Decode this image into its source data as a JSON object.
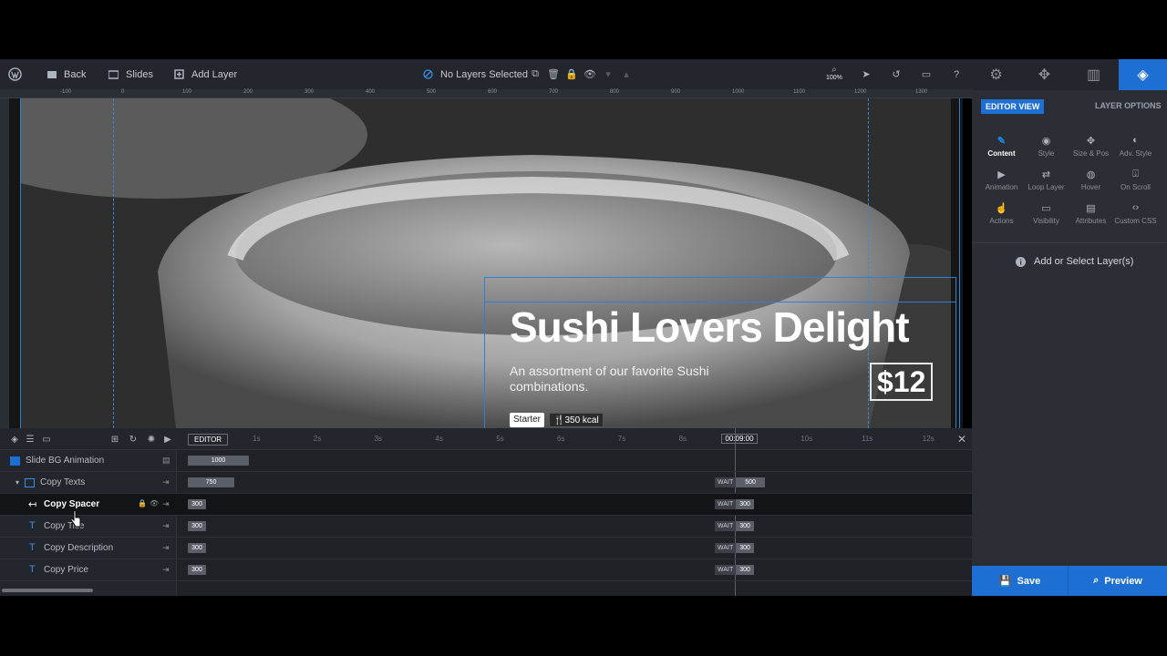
{
  "toolbar": {
    "back_label": "Back",
    "slides_label": "Slides",
    "add_layer_label": "Add Layer",
    "selection_status": "No Layers Selected",
    "zoom": "100%"
  },
  "ruler": {
    "ticks": [
      "-100",
      "0",
      "100",
      "200",
      "300",
      "400",
      "500",
      "600",
      "700",
      "800",
      "900",
      "1000",
      "1100",
      "1200",
      "1300"
    ]
  },
  "canvas": {
    "title": "Sushi Lovers Delight",
    "description": "An assortment of our favorite Sushi combinations.",
    "price": "$12",
    "tag_starter": "Starter",
    "tag_kcal": "¥¥ 350 kcal"
  },
  "timeline": {
    "editor_label": "EDITOR",
    "ticks": [
      "1s",
      "2s",
      "3s",
      "4s",
      "5s",
      "6s",
      "7s",
      "8s",
      "00:09:00",
      "10s",
      "11s",
      "12s"
    ],
    "rows": [
      {
        "name": "Slide BG Animation",
        "start": "1000",
        "wait": "",
        "end": ""
      },
      {
        "name": "Copy Texts",
        "start": "750",
        "wait": "WAIT",
        "end": "500"
      },
      {
        "name": "Copy Spacer",
        "start": "300",
        "wait": "WAIT",
        "end": "300"
      },
      {
        "name": "Copy Title",
        "start": "300",
        "wait": "WAIT",
        "end": "300"
      },
      {
        "name": "Copy Description",
        "start": "300",
        "wait": "WAIT",
        "end": "300"
      },
      {
        "name": "Copy Price",
        "start": "300",
        "wait": "WAIT",
        "end": "300"
      }
    ]
  },
  "sidebar": {
    "editor_view": "EDITOR VIEW",
    "layer_options": "LAYER OPTIONS",
    "options": [
      {
        "label": "Content",
        "icon": "pencil-icon"
      },
      {
        "label": "Style",
        "icon": "palette-icon"
      },
      {
        "label": "Size & Pos",
        "icon": "move-icon"
      },
      {
        "label": "Adv. Style",
        "icon": "contrast-icon"
      },
      {
        "label": "Animation",
        "icon": "play-icon"
      },
      {
        "label": "Loop Layer",
        "icon": "loop-icon"
      },
      {
        "label": "Hover",
        "icon": "mouse-icon"
      },
      {
        "label": "On Scroll",
        "icon": "scroll-icon"
      },
      {
        "label": "Actions",
        "icon": "hand-icon"
      },
      {
        "label": "Visibility",
        "icon": "monitor-icon"
      },
      {
        "label": "Attributes",
        "icon": "file-icon"
      },
      {
        "label": "Custom CSS",
        "icon": "code-icon"
      }
    ],
    "add_select": "Add or Select Layer(s)",
    "save_label": "Save",
    "preview_label": "Preview"
  },
  "colors": {
    "accent": "#1e6fd3",
    "toolbar": "#23272d",
    "sidebar": "#2b2f35"
  }
}
